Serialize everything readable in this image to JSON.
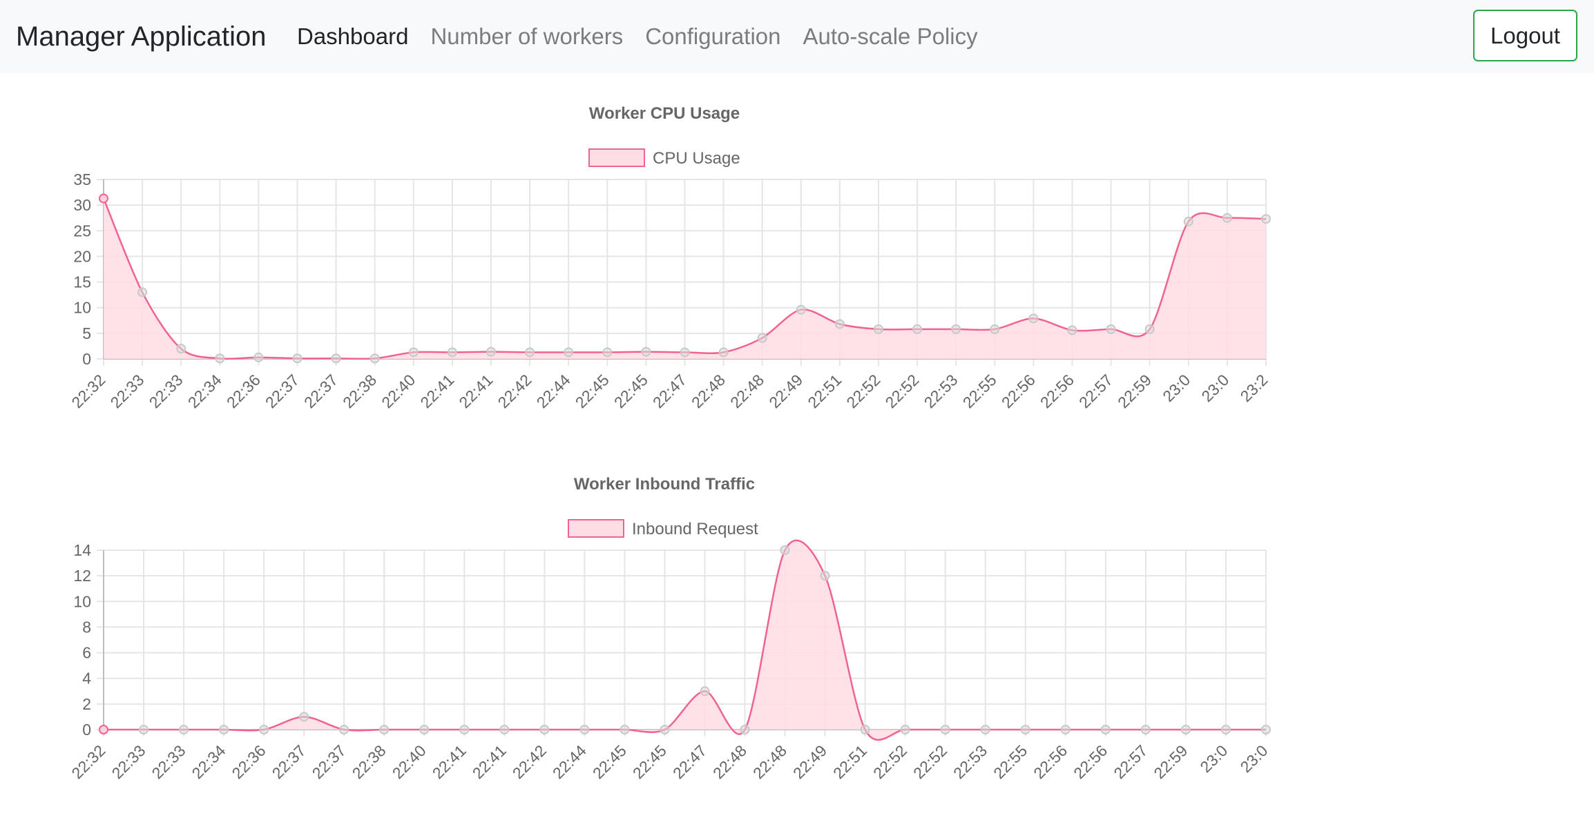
{
  "nav": {
    "brand": "Manager Application",
    "links": [
      {
        "label": "Dashboard",
        "active": true
      },
      {
        "label": "Number of workers",
        "active": false
      },
      {
        "label": "Configuration",
        "active": false
      },
      {
        "label": "Auto-scale Policy",
        "active": false
      }
    ],
    "logout_label": "Logout"
  },
  "colors": {
    "accent": "#f06292",
    "fill": "#ffdde4",
    "grid": "#e5e5e5",
    "navbar_bg": "#f8f9fa",
    "logout_border": "#28a745"
  },
  "chart_data": [
    {
      "type": "area",
      "title": "Worker CPU Usage",
      "series": [
        {
          "name": "CPU Usage",
          "values": [
            31.3,
            13,
            2,
            0.1,
            0.3,
            0.1,
            0.1,
            0.1,
            1.3,
            1.3,
            1.4,
            1.3,
            1.3,
            1.3,
            1.4,
            1.3,
            1.3,
            4.1,
            9.6,
            6.8,
            5.8,
            5.8,
            5.8,
            5.8,
            7.9,
            5.6,
            5.8,
            5.8,
            26.8,
            27.5,
            27.3
          ]
        }
      ],
      "x": [
        "22:32",
        "22:33",
        "22:33",
        "22:34",
        "22:36",
        "22:37",
        "22:37",
        "22:38",
        "22:40",
        "22:41",
        "22:41",
        "22:42",
        "22:44",
        "22:45",
        "22:45",
        "22:47",
        "22:48",
        "22:48",
        "22:49",
        "22:51",
        "22:52",
        "22:52",
        "22:53",
        "22:55",
        "22:56",
        "22:56",
        "22:57",
        "22:59",
        "23:0",
        "23:0",
        "23:2"
      ],
      "yticks": [
        0,
        5,
        10,
        15,
        20,
        25,
        30,
        35
      ],
      "ylim": [
        0,
        35
      ],
      "grid": true,
      "legend_position": "top"
    },
    {
      "type": "area",
      "title": "Worker Inbound Traffic",
      "series": [
        {
          "name": "Inbound Request",
          "values": [
            0,
            0,
            0,
            0,
            0,
            1,
            0,
            0,
            0,
            0,
            0,
            0,
            0,
            0,
            0,
            3,
            0,
            14,
            12,
            0,
            0,
            0,
            0,
            0,
            0,
            0,
            0,
            0,
            0,
            0
          ]
        }
      ],
      "x": [
        "22:32",
        "22:33",
        "22:33",
        "22:34",
        "22:36",
        "22:37",
        "22:37",
        "22:38",
        "22:40",
        "22:41",
        "22:41",
        "22:42",
        "22:44",
        "22:45",
        "22:45",
        "22:47",
        "22:48",
        "22:48",
        "22:49",
        "22:51",
        "22:52",
        "22:52",
        "22:53",
        "22:55",
        "22:56",
        "22:56",
        "22:57",
        "22:59",
        "23:0",
        "23:0"
      ],
      "yticks": [
        0,
        2,
        4,
        6,
        8,
        10,
        12,
        14
      ],
      "ylim": [
        0,
        14
      ],
      "grid": true,
      "legend_position": "top"
    }
  ]
}
